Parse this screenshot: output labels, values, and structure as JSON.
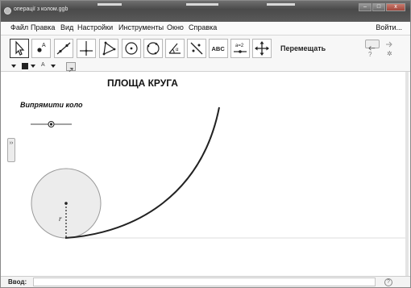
{
  "window": {
    "title": "операції з колом.ggb",
    "controls": {
      "minimize": "–",
      "maximize": "□",
      "close": "x"
    }
  },
  "menubar": {
    "items": [
      "Файл",
      "Правка",
      "Вид",
      "Настройки",
      "Инструменты",
      "Окно",
      "Справка"
    ],
    "login": "Войти..."
  },
  "toolbar": {
    "tools": [
      {
        "name": "move-tool-icon",
        "active": true
      },
      {
        "name": "point-tool-icon"
      },
      {
        "name": "line-tool-icon"
      },
      {
        "name": "perpendicular-tool-icon"
      },
      {
        "name": "polygon-tool-icon"
      },
      {
        "name": "circle-tool-icon"
      },
      {
        "name": "circle-three-points-tool-icon"
      },
      {
        "name": "angle-tool-icon"
      },
      {
        "name": "reflect-tool-icon"
      },
      {
        "name": "text-tool-icon",
        "text": "ABC"
      },
      {
        "name": "slider-tool-icon",
        "text": "a=2"
      },
      {
        "name": "move-view-tool-icon"
      }
    ],
    "active_tool_label": "Перемещать",
    "undo_icon": "undo-icon",
    "redo_icon": "redo-icon",
    "help_icon": "help-icon",
    "settings_icon": "gear-icon"
  },
  "stylebar": {
    "font_size_label": "A",
    "color": "#222222"
  },
  "graphics": {
    "title": "ПЛОЩА КРУГА",
    "slider_caption": "Випрямити коло",
    "slider_value": 0.5,
    "radius_label": "r",
    "side_toggle": "››",
    "colors": {
      "circle_fill": "#ececec",
      "curve": "#222222"
    }
  },
  "inputbar": {
    "label": "Ввод:",
    "value": "",
    "help": "?"
  }
}
